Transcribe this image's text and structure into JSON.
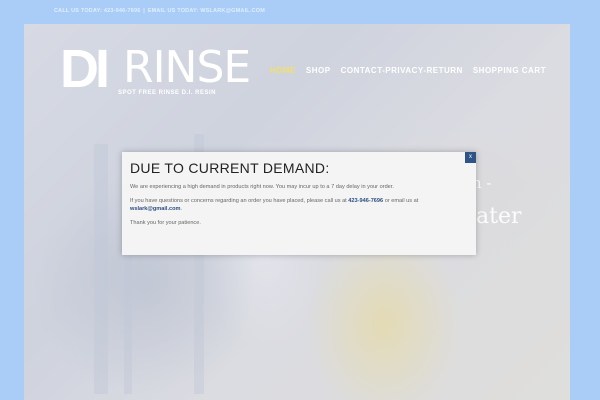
{
  "topbar": {
    "call_text": "CALL US TODAY: 423-946-7696",
    "separator": "|",
    "email_text": "EMAIL US TODAY: WSLARK@GMAIL.COM"
  },
  "logo": {
    "di": "DI",
    "rinse": "RINSE",
    "tagline": "SPOT FREE RINSE D.I. RESIN"
  },
  "nav": {
    "items": [
      {
        "label": "HOME",
        "active": true
      },
      {
        "label": "SHOP"
      },
      {
        "label": "CONTACT-PRIVACY-RETURN"
      },
      {
        "label": "SHOPPING CART"
      }
    ]
  },
  "hero": {
    "fragment_1": "n -",
    "fragment_2": "ater"
  },
  "modal": {
    "title": "DUE TO CURRENT DEMAND:",
    "para1": "We are experiencing a high demand in products right now. You may incur up to a 7 day delay in your order.",
    "para2_pre": "If you have questions or concerns regarding an order you have placed, please call us at ",
    "phone": "423-946-7696",
    "para2_mid": " or email us at ",
    "email": "wslark@gmail.com",
    "para2_post": ".",
    "para3": "Thank you for your patience.",
    "close_label": "x"
  },
  "colors": {
    "outer_bg": "#a9cdf7",
    "nav_active": "#f2e06b",
    "link": "#2a4e7e",
    "close_bg": "#2e5386"
  }
}
